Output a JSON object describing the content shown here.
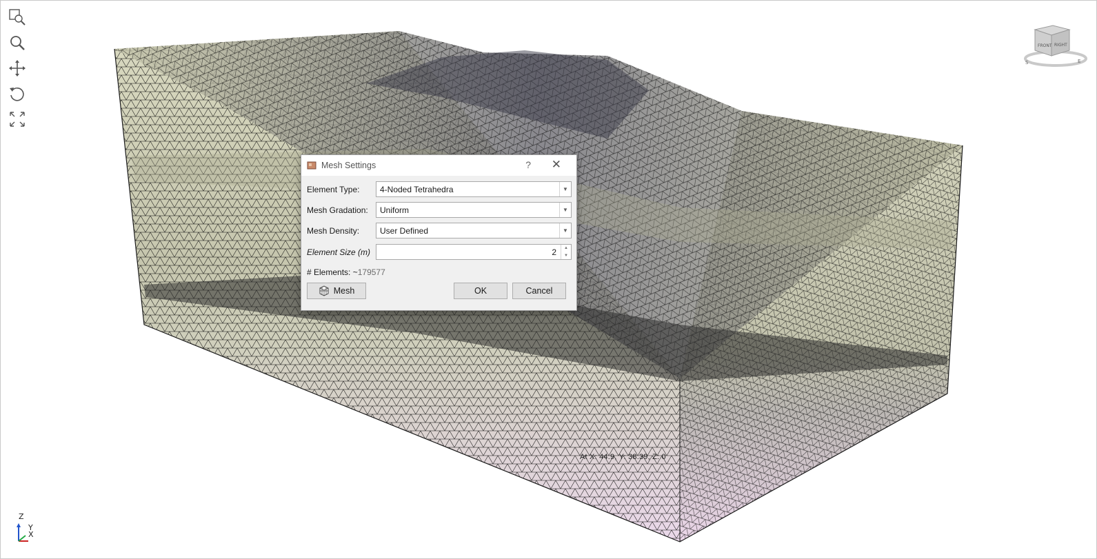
{
  "toolbar": {
    "items": [
      {
        "icon": "zoom-window-icon"
      },
      {
        "icon": "zoom-icon"
      },
      {
        "icon": "pan-icon"
      },
      {
        "icon": "rotate-icon"
      },
      {
        "icon": "zoom-extents-icon"
      }
    ]
  },
  "viewcube": {
    "front": "FRONT",
    "right": "RIGHT",
    "compass_s": "S",
    "compass_e": "E"
  },
  "coordinate_readout": "At X: 44.9, Y: 38.39, Z: 0",
  "axis_triad": {
    "z": "Z",
    "y": "Y",
    "x": "X"
  },
  "dialog": {
    "title": "Mesh Settings",
    "help": "?",
    "close": "✕",
    "element_type_label": "Element Type:",
    "element_type_value": "4-Noded Tetrahedra",
    "mesh_gradation_label": "Mesh Gradation:",
    "mesh_gradation_value": "Uniform",
    "mesh_density_label": "Mesh Density:",
    "mesh_density_value": "User Defined",
    "element_size_label": "Element Size (m)",
    "element_size_value": "2",
    "elements_label": "# Elements: ~",
    "elements_value": "179577",
    "mesh_button": "Mesh",
    "ok_button": "OK",
    "cancel_button": "Cancel"
  },
  "colors": {
    "mesh_top_soil": "#d8d8c0",
    "mesh_mid_layer": "#c7c7b0",
    "mesh_dark_layer": "#6a6a6a",
    "mesh_bottom": "#e9d6e6",
    "mesh_line": "#101010"
  }
}
